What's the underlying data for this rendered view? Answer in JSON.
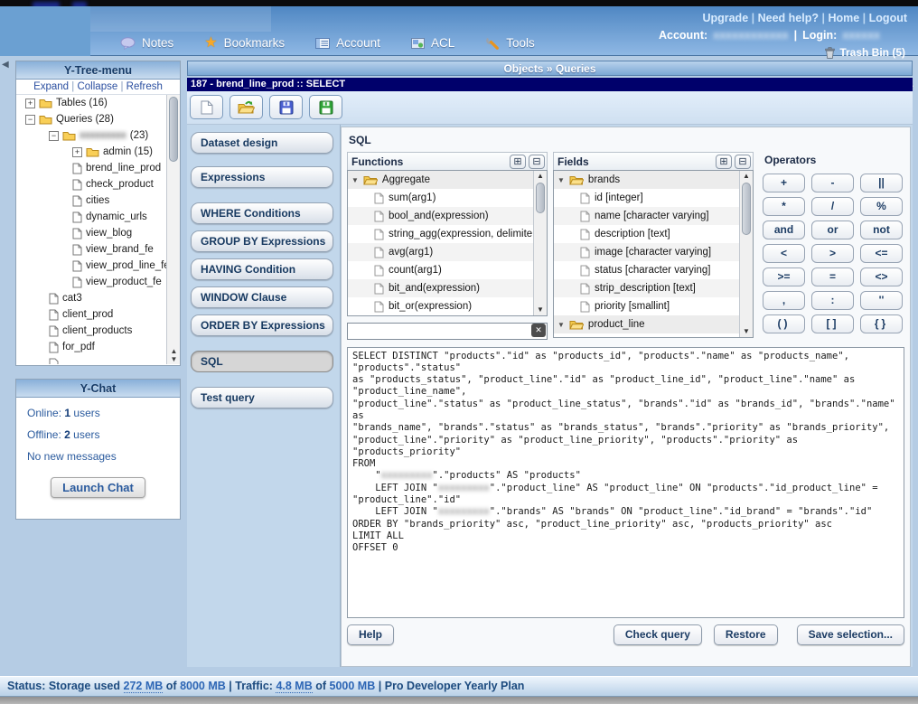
{
  "glyphs": {
    "up": "▲",
    "down": "▼",
    "tri_open": "▼",
    "left": "◀",
    "expand_all": "⊞",
    "collapse_all": "⊟",
    "clear_x": "✕",
    "plus": "+",
    "minus": "−"
  },
  "topbar": {
    "links": [
      "Upgrade",
      "Need help?",
      "Home",
      "Logout"
    ],
    "link_sep": "|",
    "account_label": "Account:",
    "account_value": "xxxxxxxxxxxx",
    "pipe": "|",
    "login_label": "Login:",
    "login_value": "xxxxxx",
    "trash_label": "Trash Bin (5)",
    "nav": [
      {
        "label": "Notes",
        "icon": "notes-balloon-icon"
      },
      {
        "label": "Bookmarks",
        "icon": "bookmark-star-icon",
        "star_glyph": "★"
      },
      {
        "label": "Account",
        "icon": "account-list-icon"
      },
      {
        "label": "ACL",
        "icon": "acl-card-icon"
      },
      {
        "label": "Tools",
        "icon": "tools-wrench-icon"
      }
    ]
  },
  "sidebar": {
    "tree_title": "Y-Tree-menu",
    "tree_links": [
      "Expand",
      "Collapse",
      "Refresh"
    ],
    "tree_link_sep": "|",
    "tree_items": [
      {
        "toggle": "+",
        "label": "Tables (16)"
      },
      {
        "toggle": "−",
        "label": "Queries (28)"
      },
      {
        "toggle": "−",
        "name": "xxxxxxxxx",
        "suffix": " (23)"
      },
      {
        "toggle": "+",
        "label": "admin (15)"
      },
      {
        "label": "brend_line_prod"
      },
      {
        "label": "check_product"
      },
      {
        "label": "cities"
      },
      {
        "label": "dynamic_urls"
      },
      {
        "label": "view_blog"
      },
      {
        "label": "view_brand_fe"
      },
      {
        "label": "view_prod_line_fe"
      },
      {
        "label": "view_product_fe"
      },
      {
        "label": "cat3"
      },
      {
        "label": "client_prod"
      },
      {
        "label": "client_products"
      },
      {
        "label": "for_pdf"
      }
    ],
    "chat_title": "Y-Chat",
    "chat_online_label": "Online:",
    "chat_online_count": "1",
    "chat_online_suffix": " users",
    "chat_offline_label": "Offline:",
    "chat_offline_count": "2",
    "chat_offline_suffix": " users",
    "chat_messages": "No new messages",
    "chat_button": "Launch Chat"
  },
  "main": {
    "breadcrumb": "Objects » Queries",
    "query_title": "187 - brend_line_prod :: SELECT",
    "toolbar_icons": [
      "new-file-icon",
      "open-folder-icon",
      "save-blue-icon",
      "save-green-icon"
    ],
    "menu_buttons": [
      "Dataset design",
      "Expressions",
      "WHERE Conditions",
      "GROUP BY Expressions",
      "HAVING Condition",
      "WINDOW Clause",
      "ORDER BY Expressions",
      "SQL",
      "Test query"
    ],
    "active_menu": "SQL",
    "section_label": "SQL",
    "functions": {
      "title": "Functions",
      "folder": "Aggregate",
      "items": [
        "sum(arg1)",
        "bool_and(expression)",
        "string_agg(expression, delimite",
        "avg(arg1)",
        "count(arg1)",
        "bit_and(expression)",
        "bit_or(expression)"
      ],
      "filter_value": ""
    },
    "fields": {
      "title": "Fields",
      "group1_folder": "brands",
      "group1_items": [
        "id [integer]",
        "name [character varying]",
        "description [text]",
        "image [character varying]",
        "status [character varying]",
        "strip_description [text]",
        "priority [smallint]"
      ],
      "group2_folder": "product_line"
    },
    "operators": {
      "title": "Operators",
      "buttons": [
        "+",
        "-",
        "||",
        "*",
        "/",
        "%",
        "and",
        "or",
        "not",
        "<",
        ">",
        "<=",
        ">=",
        "=",
        "<>",
        ",",
        ":",
        "''",
        "()",
        "[]",
        "{}"
      ]
    },
    "sql": {
      "part1": "SELECT DISTINCT \"products\".\"id\" as \"products_id\", \"products\".\"name\" as \"products_name\", \"products\".\"status\"\nas \"products_status\", \"product_line\".\"id\" as \"product_line_id\", \"product_line\".\"name\" as \"product_line_name\",\n\"product_line\".\"status\" as \"product_line_status\", \"brands\".\"id\" as \"brands_id\", \"brands\".\"name\" as\n\"brands_name\", \"brands\".\"status\" as \"brands_status\", \"brands\".\"priority\" as \"brands_priority\",\n\"product_line\".\"priority\" as \"product_line_priority\", \"products\".\"priority\" as \"products_priority\"\nFROM\n    \"",
      "blur1": "xxxxxxxxx",
      "part2": "\".\"products\" AS \"products\"\n    LEFT JOIN \"",
      "blur2": "xxxxxxxxx",
      "part3": "\".\"product_line\" AS \"product_line\" ON \"products\".\"id_product_line\" = \"product_line\".\"id\"\n    LEFT JOIN \"",
      "blur3": "xxxxxxxxx",
      "part4": "\".\"brands\" AS \"brands\" ON \"product_line\".\"id_brand\" = \"brands\".\"id\"\nORDER BY \"brands_priority\" asc, \"product_line_priority\" asc, \"products_priority\" asc\nLIMIT ALL\nOFFSET 0"
    },
    "actions": {
      "help": "Help",
      "check": "Check query",
      "restore": "Restore",
      "save": "Save selection..."
    }
  },
  "statusbar": {
    "prefix": "Status: Storage used",
    "storage_used": "272 MB",
    "of1": "of",
    "storage_total": "8000 MB",
    "sep1": "|",
    "traffic_label": "Traffic:",
    "traffic_used": "4.8 MB",
    "of2": "of",
    "traffic_total": "5000 MB",
    "sep2": "|",
    "plan": "Pro Developer Yearly Plan"
  },
  "colors": {
    "accent_navy": "#00006b",
    "banner_blue": "#4f87c3",
    "link_light": "#d9ecff",
    "status_value_blue": "#2e66b5"
  }
}
